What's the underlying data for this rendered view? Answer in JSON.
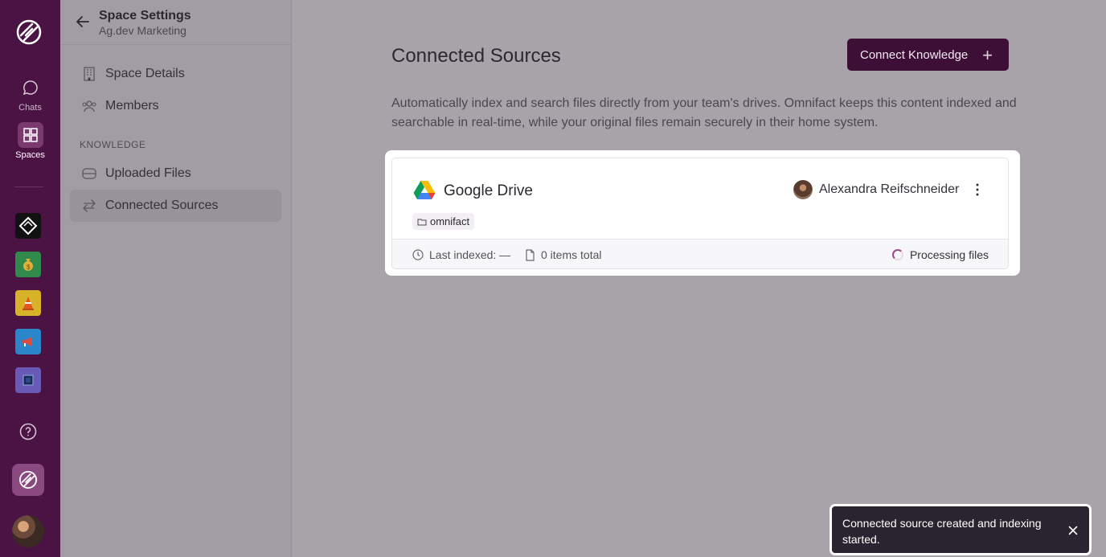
{
  "rail": {
    "chats_label": "Chats",
    "spaces_label": "Spaces"
  },
  "settings": {
    "title": "Space Settings",
    "subtitle": "Ag.dev Marketing",
    "nav": {
      "space_details": "Space Details",
      "members": "Members",
      "section_knowledge": "KNOWLEDGE",
      "uploaded_files": "Uploaded Files",
      "connected_sources": "Connected Sources"
    }
  },
  "main": {
    "title": "Connected Sources",
    "connect_button": "Connect Knowledge",
    "description": "Automatically index and search files directly from your team's drives. Omnifact keeps this content indexed and searchable in real-time, while your original files remain securely in their home system.",
    "source": {
      "name": "Google Drive",
      "folder_tag": "omnifact",
      "owner": "Alexandra Reifschneider",
      "last_indexed": "Last indexed: —",
      "items_total": "0 items total",
      "status": "Processing files"
    }
  },
  "toast": {
    "message": "Connected source created and indexing started."
  },
  "colors": {
    "rail_bg": "#4a1343",
    "accent_button": "#3d0f36",
    "overlay_bg": "#a7a3a9",
    "toast_bg": "#2a2430"
  }
}
